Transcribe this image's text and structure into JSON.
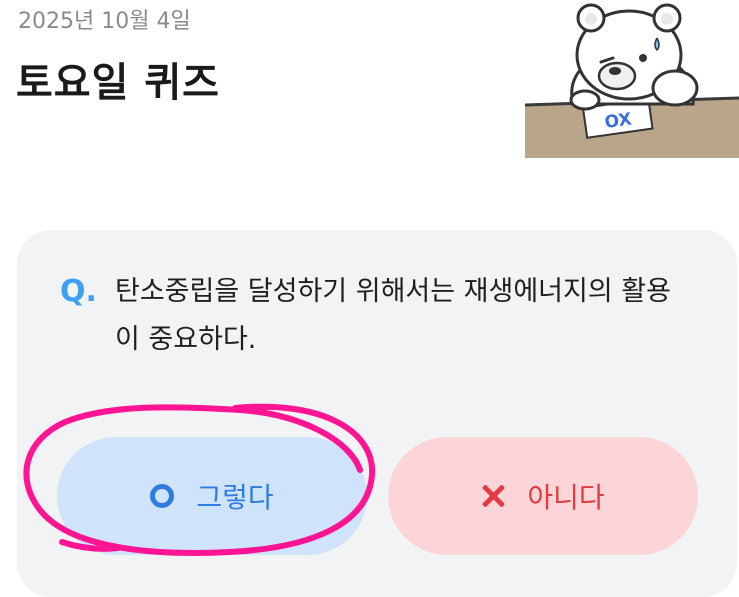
{
  "header": {
    "date": "2025년 10월 4일",
    "title": "토요일 퀴즈"
  },
  "quiz": {
    "q_label": "Q.",
    "question": "탄소중립을 달성하기 위해서는 재생에너지의 활용이 중요하다.",
    "answers": [
      {
        "label": "그렇다",
        "icon": "o-circle-icon",
        "color": "#2f7de0"
      },
      {
        "label": "아니다",
        "icon": "x-cross-icon",
        "color": "#e23b41"
      }
    ]
  },
  "mascot": {
    "icon": "bear-mascot-icon",
    "sheet_text": "OX"
  },
  "colors": {
    "accent_blue": "#3ea0f0",
    "yes_bg": "#cfe3fb",
    "no_bg": "#fbd5d8",
    "highlight": "#ff1493"
  }
}
